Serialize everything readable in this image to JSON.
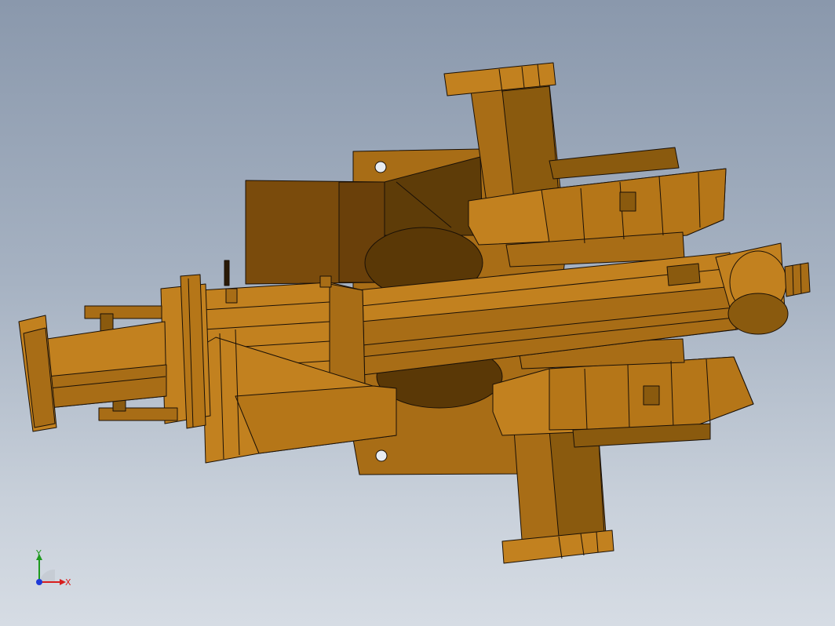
{
  "viewport": {
    "background_top": "#8a98ac",
    "background_bottom": "#d6dce4"
  },
  "model": {
    "body_color": "#c2811f",
    "shadow_color": "#8a5a0e",
    "dark_color": "#5e3c08",
    "highlight_color": "#d89a3a",
    "edge_color": "#1a1006"
  },
  "triad": {
    "x_label": "X",
    "y_label": "Y",
    "x_color": "#d81e1e",
    "y_color": "#1e9a1e",
    "z_color": "#1e3ad8"
  }
}
